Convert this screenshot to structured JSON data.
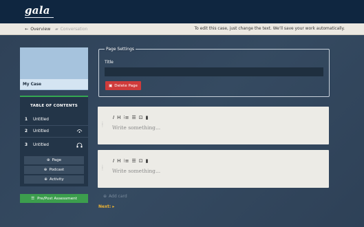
{
  "app": {
    "logo": "gala"
  },
  "subbar": {
    "back_label": "Overview",
    "conversation_label": "Conversation",
    "notice": "To edit this case, just change the text. We’ll save your work automatically."
  },
  "sidebar": {
    "case_title": "My Case",
    "toc_header": "TABLE OF CONTENTS",
    "items": [
      {
        "num": "1",
        "label": "Untitled"
      },
      {
        "num": "2",
        "label": "Untitled"
      },
      {
        "num": "3",
        "label": "Untitled"
      }
    ],
    "add_buttons": [
      "Page",
      "Podcast",
      "Activity"
    ],
    "assessment_label": "Pre/Post Assessment"
  },
  "settings": {
    "legend": "Page Settings",
    "title_label": "Title",
    "title_value": "",
    "delete_label": "Delete Page"
  },
  "editors": [
    {
      "placeholder": "Write something..."
    },
    {
      "placeholder": "Write something..."
    }
  ],
  "footer": {
    "add_card_label": "Add card",
    "next_label": "Next: ▸"
  },
  "colors": {
    "topbar": "#0f2640",
    "page_bg": "#2f4258",
    "accent_green": "#3c9e4d",
    "danger": "#cf3b3b",
    "next_link": "#f2b632"
  }
}
